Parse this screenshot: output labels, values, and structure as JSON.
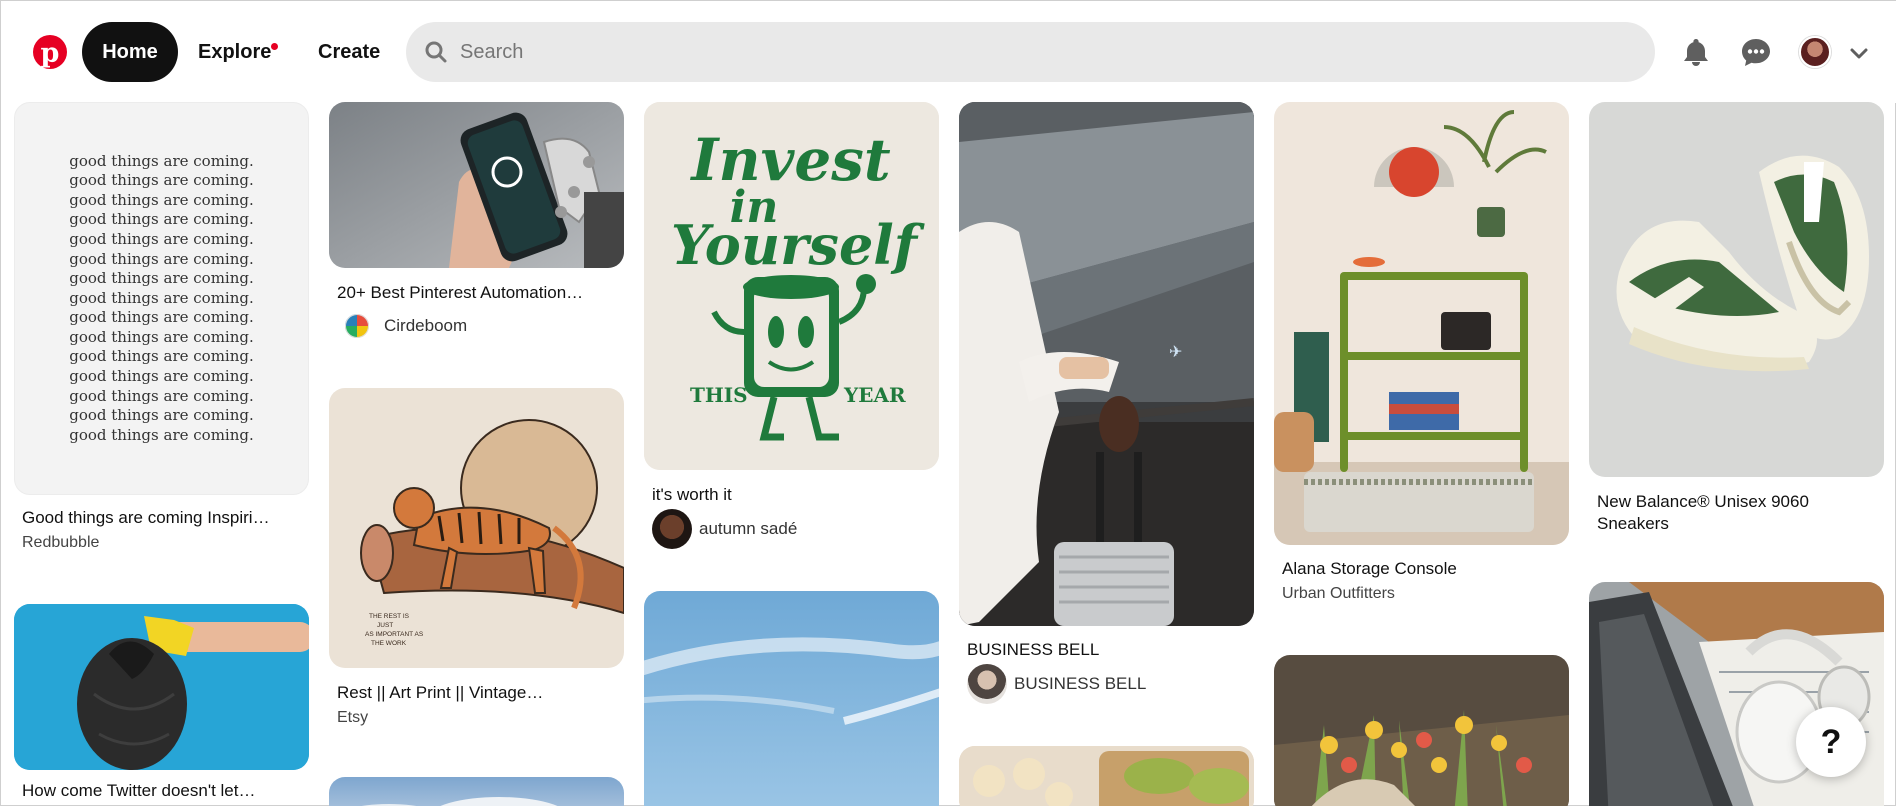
{
  "header": {
    "logo_letter": "p",
    "nav": {
      "home": "Home",
      "explore": "Explore",
      "create": "Create"
    },
    "search": {
      "placeholder": "Search",
      "value": ""
    },
    "icons": [
      "bell-icon",
      "messages-icon",
      "profile-avatar",
      "chevron-down-icon"
    ]
  },
  "pins": {
    "good_things": {
      "text_lines": [
        "good things are coming.",
        "good things are coming.",
        "good things are coming.",
        "good things are coming.",
        "good things are coming.",
        "good things are coming.",
        "good things are coming.",
        "good things are coming.",
        "good things are coming.",
        "good things are coming.",
        "good things are coming.",
        "good things are coming.",
        "good things are coming.",
        "good things are coming.",
        "good things are coming."
      ],
      "title": "Good things are coming Inspiri…",
      "source": "Redbubble"
    },
    "twitter": {
      "title": "How come Twitter doesn't let…"
    },
    "pinterest_automation": {
      "title": "20+ Best Pinterest Automation…",
      "author": "Cirdeboom"
    },
    "tiger": {
      "art_caption": "THE REST IS JUST AS IMPORTANT AS THE WORK",
      "title": "Rest || Art Print || Vintage…",
      "source": "Etsy"
    },
    "invest": {
      "art_line1": "Invest",
      "art_line2": "in",
      "art_line3": "Yourself",
      "art_this": "THIS",
      "art_year": "YEAR",
      "title": "it's worth it",
      "author": "autumn sadé"
    },
    "business": {
      "title": "BUSINESS BELL",
      "author": "BUSINESS BELL"
    },
    "alana": {
      "title": "Alana Storage Console",
      "source": "Urban Outfitters"
    },
    "sneakers": {
      "title": "New Balance® Unisex 9060 Sneakers"
    }
  },
  "help": {
    "label": "?"
  }
}
